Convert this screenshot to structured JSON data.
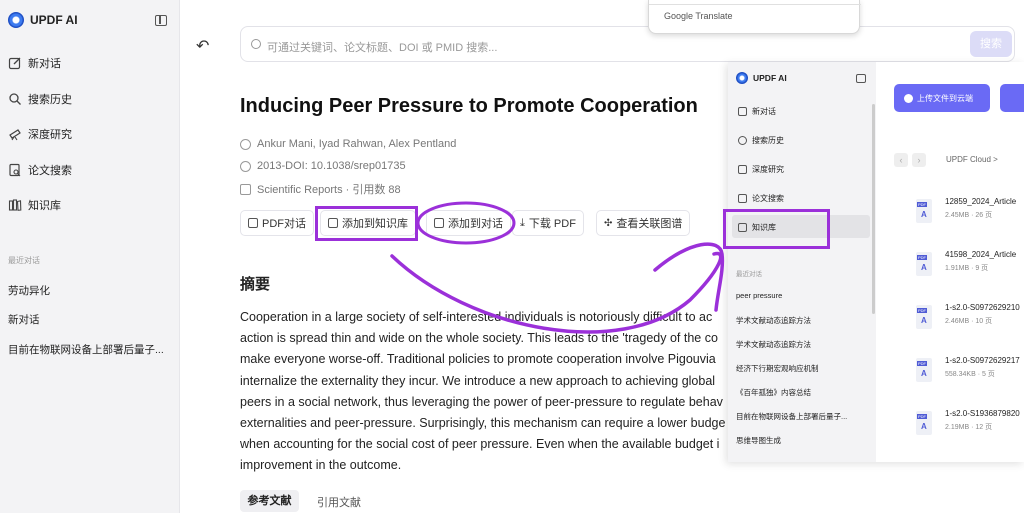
{
  "app": {
    "name": "UPDF AI"
  },
  "sidebar": {
    "items": [
      {
        "label": "新对话",
        "icon": "edit-icon"
      },
      {
        "label": "搜索历史",
        "icon": "search-icon"
      },
      {
        "label": "深度研究",
        "icon": "telescope-icon"
      },
      {
        "label": "论文搜索",
        "icon": "document-search-icon"
      },
      {
        "label": "知识库",
        "icon": "library-icon"
      }
    ],
    "recent_label": "最近对话",
    "recent": [
      "劳动异化",
      "新对话",
      "目前在物联网设备上部署后量子..."
    ]
  },
  "search": {
    "placeholder": "可通过关键词、论文标题、DOI 或 PMID 搜索...",
    "button": "搜索"
  },
  "google_translate": {
    "label": "Google Translate"
  },
  "paper": {
    "title": "Inducing Peer Pressure to Promote Cooperation",
    "authors": "Ankur Mani, Iyad Rahwan, Alex Pentland",
    "doi": "2013-DOI: 10.1038/srep01735",
    "journal": "Scientific Reports · 引用数 88"
  },
  "actions": {
    "pdf_chat": "PDF对话",
    "add_kb": "添加到知识库",
    "add_chat": "添加到对话",
    "download": "下载 PDF",
    "graph": "查看关联图谱"
  },
  "abstract": {
    "heading": "摘要",
    "lines": [
      "Cooperation in a large society of self-interested individuals is notoriously difficult to ac",
      "action is spread thin and wide on the whole society. This leads to the 'tragedy of the co",
      "make everyone worse-off. Traditional policies to promote cooperation involve Pigouvia",
      "internalize the externality they incur. We introduce a new approach to achieving global",
      "peers in a social network, thus leveraging the power of peer-pressure to regulate behav",
      "externalities and peer-pressure. Surprisingly, this mechanism can require a lower budge",
      "when accounting for the social cost of peer pressure. Even when the available budget i",
      "improvement in the outcome."
    ]
  },
  "tabs": {
    "references": "参考文献",
    "citations": "引用文献"
  },
  "overlay": {
    "app_name": "UPDF AI",
    "nav": [
      "新对话",
      "搜索历史",
      "深度研究",
      "论文搜索",
      "知识库"
    ],
    "recent_label": "最近对话",
    "recent": [
      "peer pressure",
      "学术文献动态追踪方法",
      "学术文献动态追踪方法",
      "经济下行期宏观响应机制",
      "《百年孤独》内容总结",
      "目前在物联网设备上部署后量子...",
      "思维导图生成"
    ],
    "upload_label": "上传文件到云端",
    "breadcrumb": "UPDF Cloud  >",
    "files": [
      {
        "name": "12859_2024_Article",
        "meta": "2.45MB · 26 页"
      },
      {
        "name": "41598_2024_Article",
        "meta": "1.91MB · 9 页"
      },
      {
        "name": "1-s2.0-S0972629210",
        "meta": "2.46MB · 10 页"
      },
      {
        "name": "1-s2.0-S0972629217",
        "meta": "558.34KB · 5 页"
      },
      {
        "name": "1-s2.0-S1936879820",
        "meta": "2.19MB · 12 页"
      }
    ]
  },
  "colors": {
    "accent": "#6a6af5",
    "annotation": "#9b30d9"
  }
}
